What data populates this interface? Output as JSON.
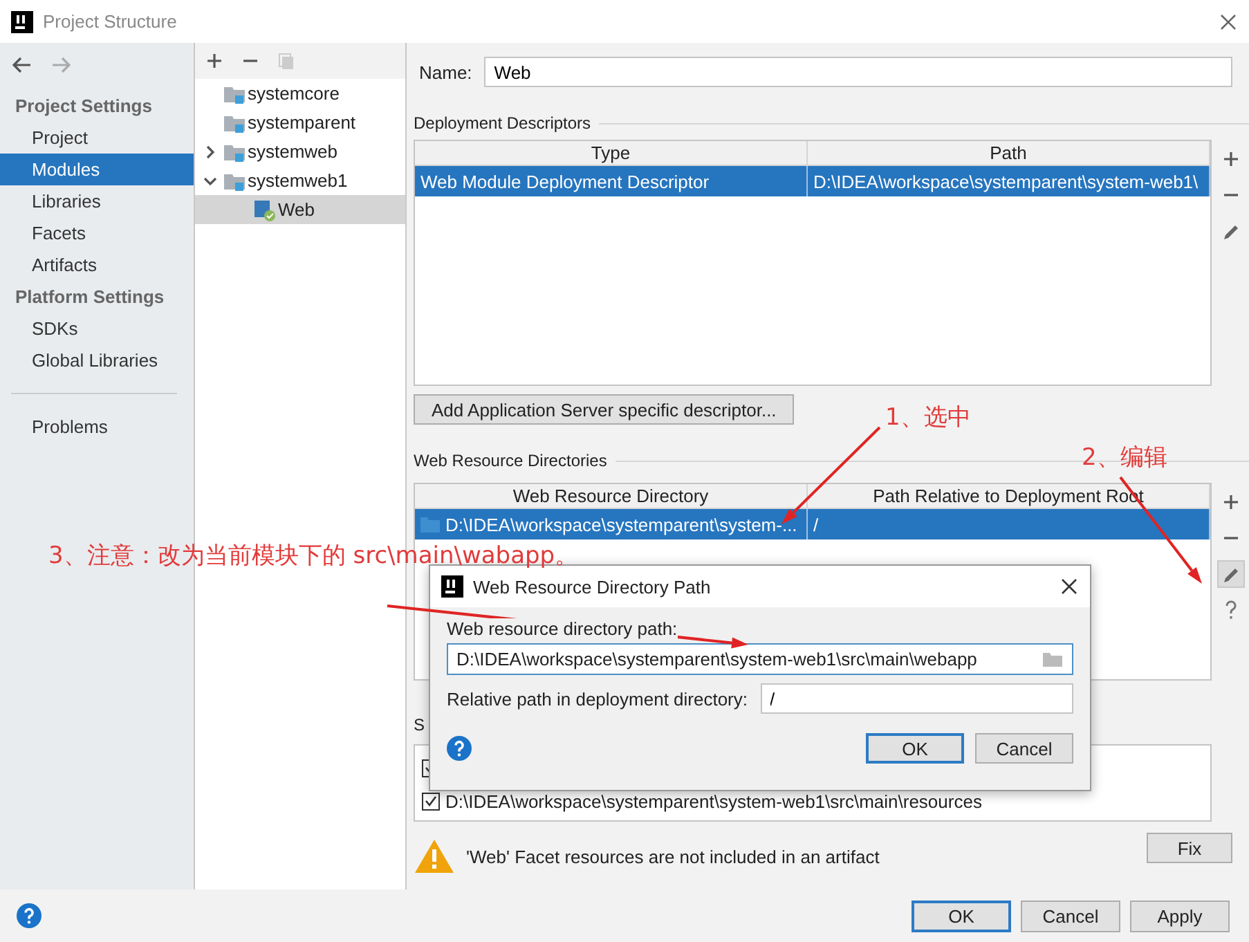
{
  "window": {
    "title": "Project Structure"
  },
  "sidebar": {
    "sections": [
      {
        "heading": "Project Settings",
        "items": [
          {
            "label": "Project",
            "selected": false
          },
          {
            "label": "Modules",
            "selected": true
          },
          {
            "label": "Libraries",
            "selected": false
          },
          {
            "label": "Facets",
            "selected": false
          },
          {
            "label": "Artifacts",
            "selected": false
          }
        ]
      },
      {
        "heading": "Platform Settings",
        "items": [
          {
            "label": "SDKs",
            "selected": false
          },
          {
            "label": "Global Libraries",
            "selected": false
          }
        ]
      }
    ],
    "bottom_items": [
      {
        "label": "Problems",
        "selected": false
      }
    ]
  },
  "tree": {
    "items": [
      {
        "label": "systemcore",
        "kind": "module",
        "selected": false
      },
      {
        "label": "systemparent",
        "kind": "module",
        "selected": false
      },
      {
        "label": "systemweb",
        "kind": "module",
        "expanded": false,
        "selected": false
      },
      {
        "label": "systemweb1",
        "kind": "module",
        "expanded": true,
        "selected": false,
        "children": [
          {
            "label": "Web",
            "kind": "web",
            "selected": true
          }
        ]
      }
    ]
  },
  "name_field": {
    "label": "Name:",
    "value": "Web"
  },
  "deployment_descriptors": {
    "title": "Deployment Descriptors",
    "columns": [
      "Type",
      "Path"
    ],
    "rows": [
      {
        "cells": [
          "Web Module Deployment Descriptor",
          "D:\\IDEA\\workspace\\systemparent\\system-web1\\"
        ],
        "selected": true
      }
    ],
    "add_button": "Add Application Server specific descriptor..."
  },
  "web_resource_directories": {
    "title": "Web Resource Directories",
    "columns": [
      "Web Resource Directory",
      "Path Relative to Deployment Root"
    ],
    "rows": [
      {
        "cells": [
          "D:\\IDEA\\workspace\\systemparent\\system-...",
          "/"
        ],
        "selected": true
      }
    ]
  },
  "source_roots": {
    "title": "S",
    "rows": [
      {
        "checked": true
      },
      {
        "checked": true,
        "path": "D:\\IDEA\\workspace\\systemparent\\system-web1\\src\\main\\resources"
      }
    ]
  },
  "warning": {
    "text": "'Web' Facet resources are not included in an artifact",
    "button": "Fix"
  },
  "footer_buttons": [
    {
      "label": "OK",
      "default": true
    },
    {
      "label": "Cancel",
      "default": false
    },
    {
      "label": "Apply",
      "default": false
    }
  ],
  "dialog": {
    "title": "Web Resource Directory Path",
    "path_label": "Web resource directory path:",
    "path_value": "D:\\IDEA\\workspace\\systemparent\\system-web1\\src\\main\\webapp",
    "relative_label": "Relative path in deployment directory:",
    "relative_value": "/",
    "buttons": [
      {
        "label": "OK",
        "default": true
      },
      {
        "label": "Cancel",
        "default": false
      }
    ]
  },
  "annotations": [
    {
      "text": "1、选中"
    },
    {
      "text": "2、编辑"
    },
    {
      "text": "3、注意：改为当前模块下的 src\\main\\wabapp。"
    }
  ]
}
